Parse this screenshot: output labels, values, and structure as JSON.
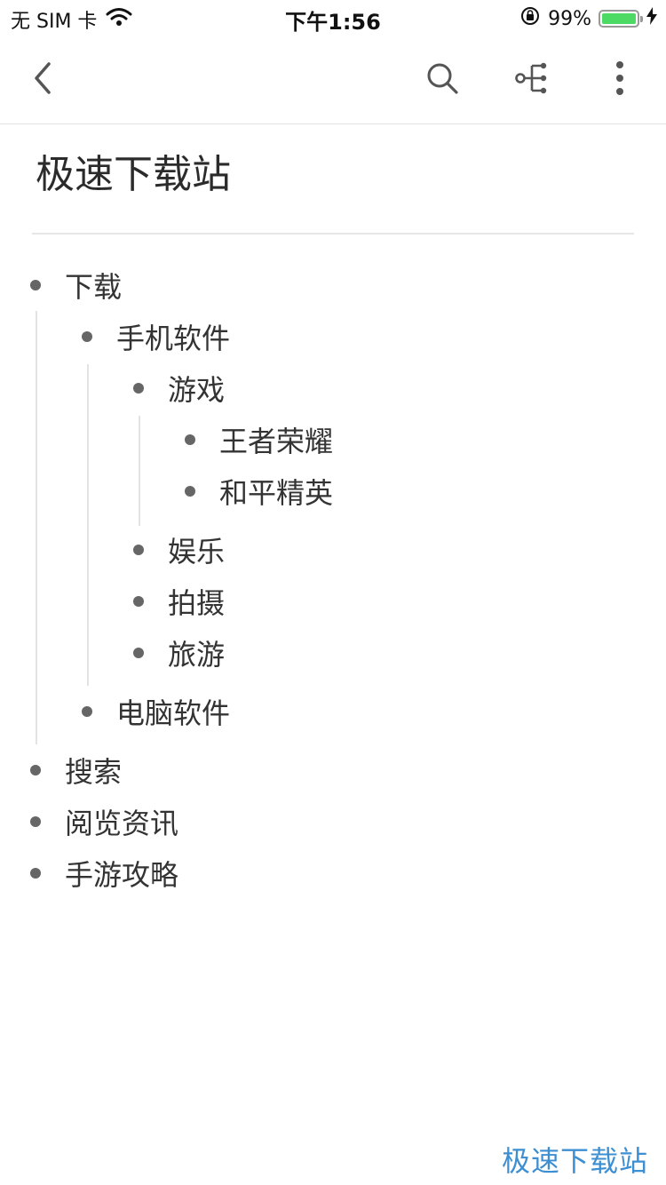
{
  "status_bar": {
    "carrier": "无 SIM 卡",
    "time": "下午1:56",
    "battery_percent": "99%",
    "battery_level": 0.99
  },
  "nav": {
    "back_icon": "chevron-left-icon",
    "search_icon": "search-icon",
    "mindmap_icon": "mindmap-icon",
    "more_icon": "more-vertical-icon"
  },
  "document": {
    "title": "极速下载站",
    "outline": [
      {
        "label": "下载"
      },
      {
        "label": "手机软件"
      },
      {
        "label": "游戏"
      },
      {
        "label": "王者荣耀"
      },
      {
        "label": "和平精英"
      },
      {
        "label": "娱乐"
      },
      {
        "label": "拍摄"
      },
      {
        "label": "旅游"
      },
      {
        "label": "电脑软件"
      },
      {
        "label": "搜索"
      },
      {
        "label": "阅览资讯"
      },
      {
        "label": "手游攻略"
      }
    ]
  },
  "watermark": "极速下载站",
  "colors": {
    "battery": "#4cd964",
    "watermark": "#3d8fd2"
  }
}
